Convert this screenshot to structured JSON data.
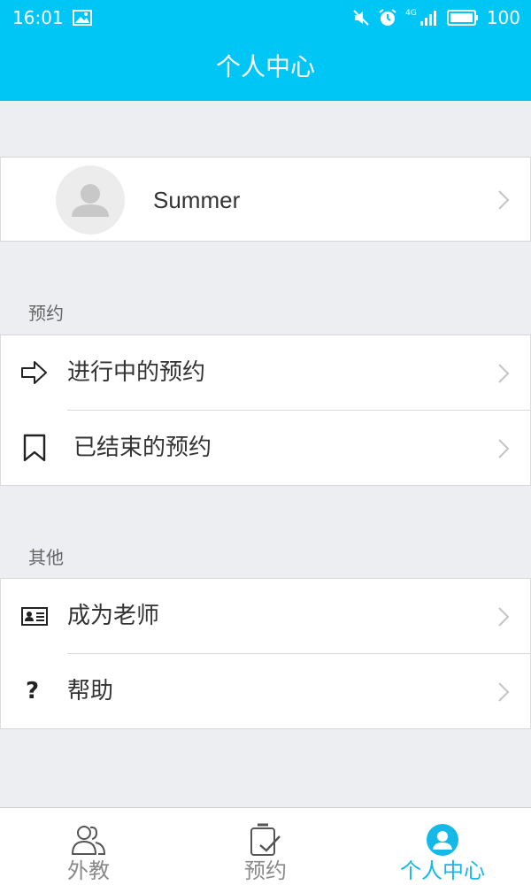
{
  "status_bar": {
    "time": "16:01",
    "network_type": "4G",
    "battery_level": "100"
  },
  "header": {
    "title": "个人中心"
  },
  "profile": {
    "name": "Summer"
  },
  "sections": {
    "booking": {
      "title": "预约",
      "items": [
        {
          "label": "进行中的预约",
          "icon": "arrow-right-outline-icon"
        },
        {
          "label": "已结束的预约",
          "icon": "bookmark-icon"
        }
      ]
    },
    "other": {
      "title": "其他",
      "items": [
        {
          "label": "成为老师",
          "icon": "id-card-icon"
        },
        {
          "label": "帮助",
          "icon": "question-icon"
        }
      ]
    }
  },
  "help_mark": "?",
  "tabs": [
    {
      "label": "外教",
      "icon": "users-icon",
      "active": false
    },
    {
      "label": "预约",
      "icon": "clipboard-check-icon",
      "active": false
    },
    {
      "label": "个人中心",
      "icon": "user-circle-icon",
      "active": true
    }
  ],
  "colors": {
    "primary": "#00c6f5",
    "active_tab": "#14b9e8",
    "background": "#eceef2"
  }
}
